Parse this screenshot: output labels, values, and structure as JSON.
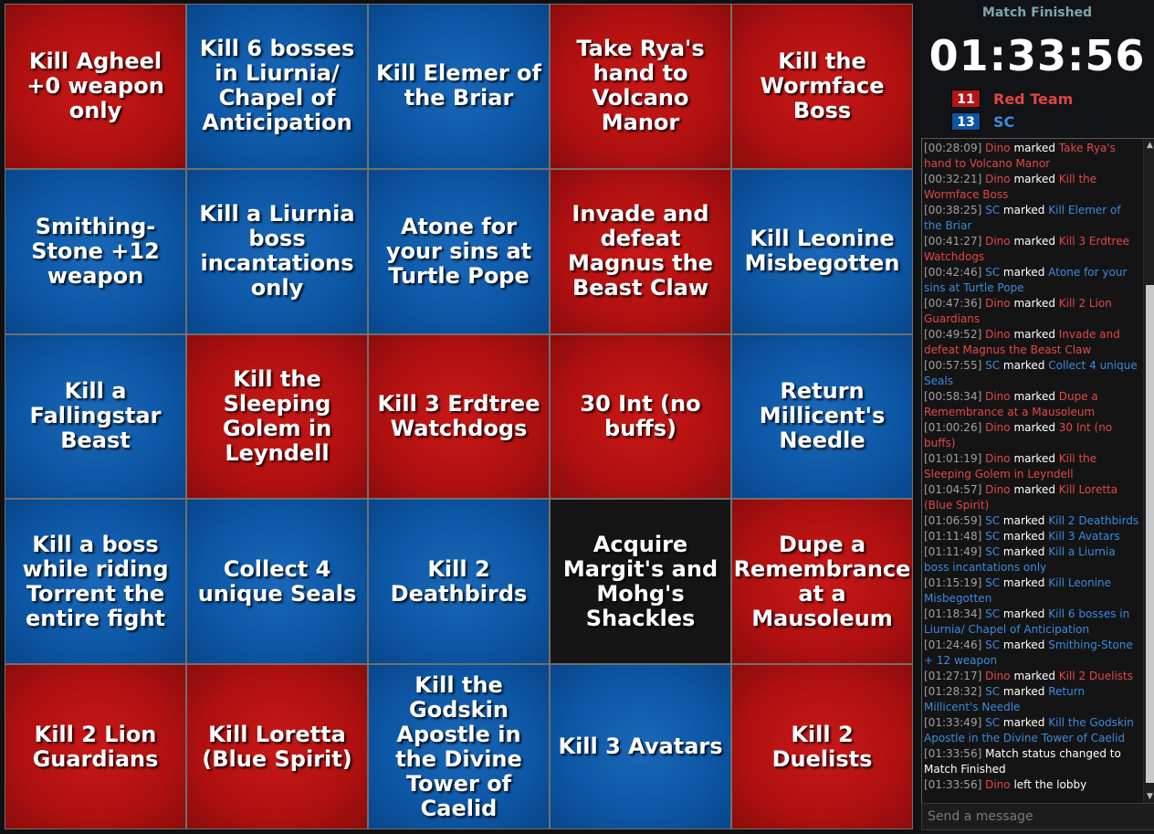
{
  "colors": {
    "red": "#b61515",
    "blue": "#0d56a3",
    "black": "#151515"
  },
  "board": [
    {
      "text": "Kill Agheel +0 weapon only",
      "color": "red"
    },
    {
      "text": "Kill 6 bosses in Liurnia/ Chapel of Anticipation",
      "color": "blue"
    },
    {
      "text": "Kill Elemer of the Briar",
      "color": "blue"
    },
    {
      "text": "Take Rya's hand to Volcano Manor",
      "color": "red"
    },
    {
      "text": "Kill the Wormface Boss",
      "color": "red"
    },
    {
      "text": "Smithing-Stone +12 weapon",
      "color": "blue"
    },
    {
      "text": "Kill a Liurnia boss incantations only",
      "color": "blue"
    },
    {
      "text": "Atone for your sins at Turtle Pope",
      "color": "blue"
    },
    {
      "text": "Invade and defeat Magnus the Beast Claw",
      "color": "red"
    },
    {
      "text": "Kill Leonine Misbegotten",
      "color": "blue"
    },
    {
      "text": "Kill a Fallingstar Beast",
      "color": "blue"
    },
    {
      "text": "Kill the Sleeping Golem in Leyndell",
      "color": "red"
    },
    {
      "text": "Kill 3 Erdtree Watchdogs",
      "color": "red"
    },
    {
      "text": "30 Int (no buffs)",
      "color": "red"
    },
    {
      "text": "Return Millicent's Needle",
      "color": "blue"
    },
    {
      "text": "Kill a boss while riding Torrent the entire fight",
      "color": "blue"
    },
    {
      "text": "Collect 4 unique Seals",
      "color": "blue"
    },
    {
      "text": "Kill 2 Deathbirds",
      "color": "blue"
    },
    {
      "text": "Acquire Margit's and Mohg's Shackles",
      "color": "black"
    },
    {
      "text": "Dupe a Remembrance at a Mausoleum",
      "color": "red"
    },
    {
      "text": "Kill 2 Lion Guardians",
      "color": "red"
    },
    {
      "text": "Kill Loretta (Blue Spirit)",
      "color": "red"
    },
    {
      "text": "Kill the Godskin Apostle in the Divine Tower of Caelid",
      "color": "blue"
    },
    {
      "text": "Kill 3 Avatars",
      "color": "blue"
    },
    {
      "text": "Kill 2 Duelists",
      "color": "red"
    }
  ],
  "status": "Match Finished",
  "timer": "01:33:56",
  "teams": [
    {
      "name": "Red Team",
      "count": "11",
      "color": "red"
    },
    {
      "name": "SC",
      "count": "13",
      "color": "blue"
    }
  ],
  "log": [
    {
      "time": "[00:28:09]",
      "who": "Dino",
      "team": "red",
      "action": " marked ",
      "goal": "Take Rya's hand to Volcano Manor"
    },
    {
      "time": "[00:32:21]",
      "who": "Dino",
      "team": "red",
      "action": " marked ",
      "goal": "Kill the Wormface Boss"
    },
    {
      "time": "[00:38:25]",
      "who": "SC",
      "team": "blue",
      "action": " marked ",
      "goal": "Kill Elemer of the Briar"
    },
    {
      "time": "[00:41:27]",
      "who": "Dino",
      "team": "red",
      "action": " marked ",
      "goal": "Kill 3 Erdtree Watchdogs"
    },
    {
      "time": "[00:42:46]",
      "who": "SC",
      "team": "blue",
      "action": " marked ",
      "goal": "Atone for your sins at Turtle Pope"
    },
    {
      "time": "[00:47:36]",
      "who": "Dino",
      "team": "red",
      "action": " marked ",
      "goal": "Kill 2 Lion Guardians"
    },
    {
      "time": "[00:49:52]",
      "who": "Dino",
      "team": "red",
      "action": " marked ",
      "goal": "Invade and defeat Magnus the Beast Claw"
    },
    {
      "time": "[00:57:55]",
      "who": "SC",
      "team": "blue",
      "action": " marked ",
      "goal": "Collect 4 unique Seals"
    },
    {
      "time": "[00:58:34]",
      "who": "Dino",
      "team": "red",
      "action": " marked ",
      "goal": "Dupe a Remembrance at a Mausoleum"
    },
    {
      "time": "[01:00:26]",
      "who": "Dino",
      "team": "red",
      "action": " marked ",
      "goal": "30 Int (no buffs)"
    },
    {
      "time": "[01:01:19]",
      "who": "Dino",
      "team": "red",
      "action": " marked ",
      "goal": "Kill the Sleeping Golem in Leyndell"
    },
    {
      "time": "[01:04:57]",
      "who": "Dino",
      "team": "red",
      "action": " marked ",
      "goal": "Kill Loretta (Blue Spirit)"
    },
    {
      "time": "[01:06:59]",
      "who": "SC",
      "team": "blue",
      "action": " marked ",
      "goal": "Kill 2 Deathbirds"
    },
    {
      "time": "[01:11:48]",
      "who": "SC",
      "team": "blue",
      "action": " marked ",
      "goal": "Kill 3 Avatars"
    },
    {
      "time": "[01:11:49]",
      "who": "SC",
      "team": "blue",
      "action": " marked ",
      "goal": "Kill a Liurnia boss incantations only"
    },
    {
      "time": "[01:15:19]",
      "who": "SC",
      "team": "blue",
      "action": " marked ",
      "goal": "Kill Leonine Misbegotten"
    },
    {
      "time": "[01:18:34]",
      "who": "SC",
      "team": "blue",
      "action": " marked ",
      "goal": "Kill 6 bosses in Liurnia/ Chapel of Anticipation"
    },
    {
      "time": "[01:24:46]",
      "who": "SC",
      "team": "blue",
      "action": " marked ",
      "goal": "Smithing-Stone + 12 weapon"
    },
    {
      "time": "[01:27:17]",
      "who": "Dino",
      "team": "red",
      "action": " marked ",
      "goal": "Kill 2 Duelists"
    },
    {
      "time": "[01:28:32]",
      "who": "SC",
      "team": "blue",
      "action": " marked ",
      "goal": "Return Millicent's Needle"
    },
    {
      "time": "[01:33:49]",
      "who": "SC",
      "team": "blue",
      "action": " marked ",
      "goal": "Kill the Godskin Apostle in the Divine Tower of Caelid"
    },
    {
      "time": "[01:33:56]",
      "who": "",
      "team": "none",
      "action": " Match status changed to Match Finished",
      "goal": ""
    },
    {
      "time": "[01:33:56]",
      "who": "Dino",
      "team": "red",
      "action": " left the lobby",
      "goal": ""
    }
  ],
  "chat": {
    "placeholder": "Send a message"
  },
  "icons": {
    "scroll_up": "scroll-up-arrow-icon",
    "scroll_down": "scroll-down-arrow-icon"
  }
}
